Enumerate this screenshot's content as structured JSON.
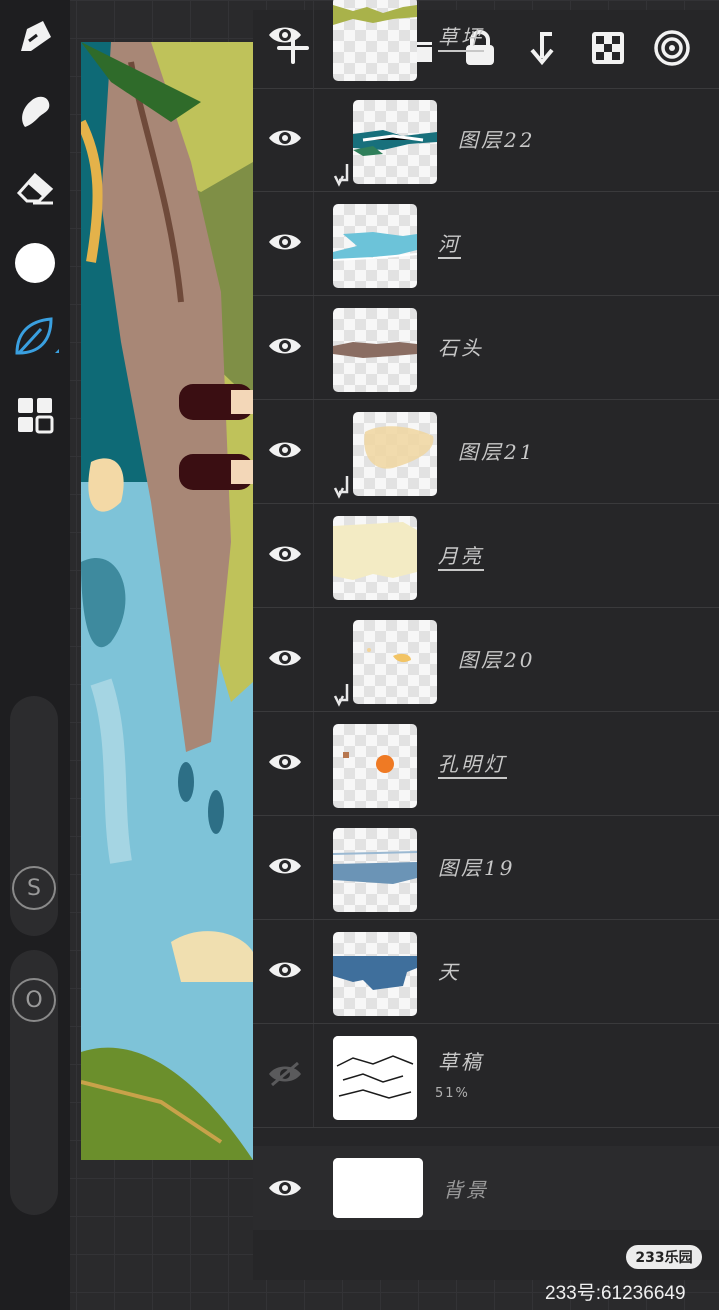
{
  "toolbar": {
    "tools": [
      "brush-icon",
      "smudge-icon",
      "eraser-icon",
      "color-swatch",
      "leaf-brush-icon",
      "layers-grid-icon"
    ],
    "size_label": "S",
    "opacity_label": "O"
  },
  "panel_toolbar": {
    "icons": [
      "add-layer-icon",
      "folder-icon",
      "lock-icon",
      "merge-down-icon",
      "transparency-lock-icon",
      "blend-mode-icon"
    ]
  },
  "layers": [
    {
      "name": "草坪",
      "visible": true,
      "clipped": false,
      "active": true
    },
    {
      "name": "图层22",
      "visible": true,
      "clipped": true,
      "active": false
    },
    {
      "name": "河",
      "visible": true,
      "clipped": false,
      "active": true
    },
    {
      "name": "石头",
      "visible": true,
      "clipped": false,
      "active": false
    },
    {
      "name": "图层21",
      "visible": true,
      "clipped": true,
      "active": false
    },
    {
      "name": "月亮",
      "visible": true,
      "clipped": false,
      "active": true
    },
    {
      "name": "图层20",
      "visible": true,
      "clipped": true,
      "active": false
    },
    {
      "name": "孔明灯",
      "visible": true,
      "clipped": false,
      "active": true
    },
    {
      "name": "图层19",
      "visible": true,
      "clipped": false,
      "active": false
    },
    {
      "name": "天",
      "visible": true,
      "clipped": false,
      "active": false
    },
    {
      "name": "草稿",
      "visible": false,
      "clipped": false,
      "active": false,
      "opacity": "51%"
    },
    {
      "name": "背景",
      "visible": true,
      "clipped": false,
      "active": false
    }
  ],
  "watermark": {
    "logo": "233乐园",
    "id_text": "233号:61236649"
  },
  "colors": {
    "accent": "#3aa0e0",
    "panel_bg": "#262628",
    "toolbar_bg": "#1e1e20"
  }
}
